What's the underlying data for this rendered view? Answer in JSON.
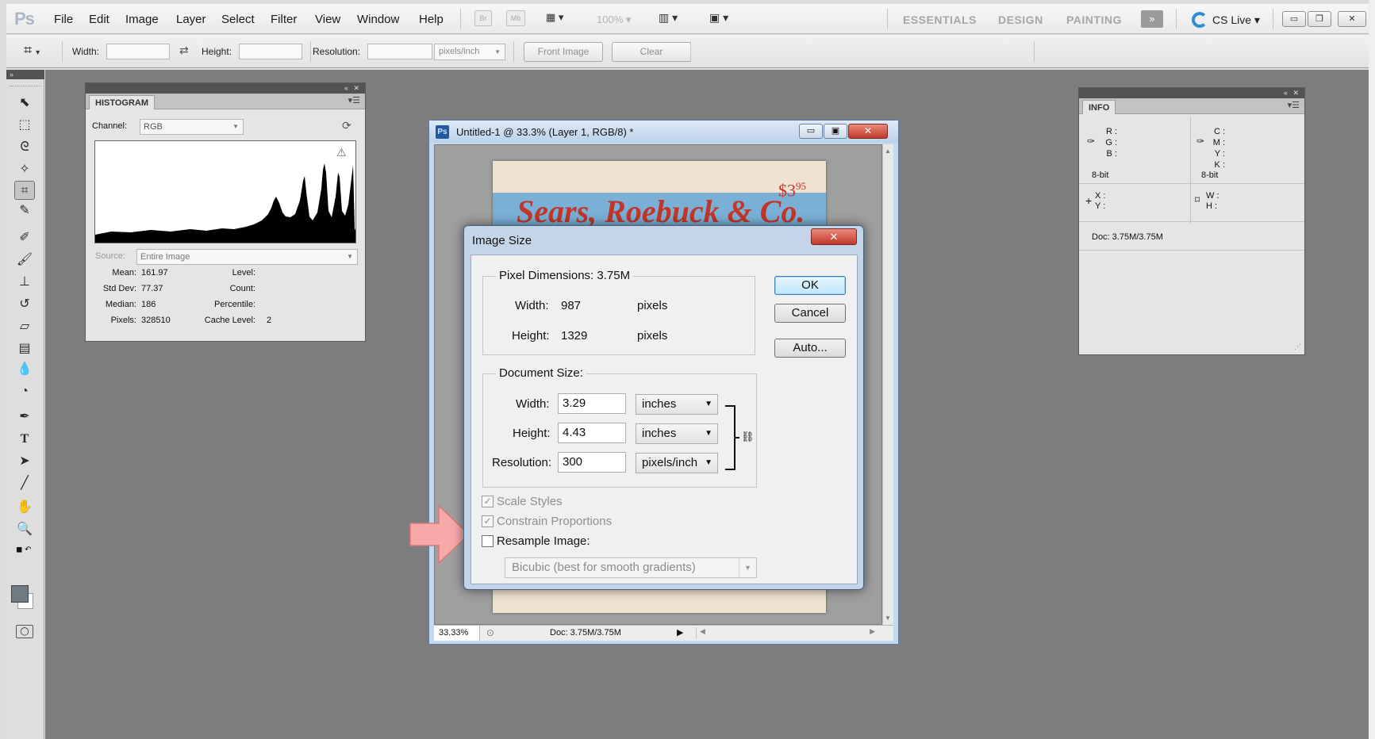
{
  "app": {
    "logo": "Ps",
    "menus": [
      "File",
      "Edit",
      "Image",
      "Layer",
      "Select",
      "Filter",
      "View",
      "Window",
      "Help"
    ],
    "menu_icons": [
      "Br",
      "Mb"
    ],
    "zoom_display": "100%",
    "workspaces": [
      "ESSENTIALS",
      "DESIGN",
      "PAINTING"
    ],
    "more_workspaces_icon": "double-chevron-icon",
    "cs_live": "CS Live",
    "accent_color": "#2a8fd3"
  },
  "options_bar": {
    "width_label": "Width:",
    "width_value": "",
    "height_label": "Height:",
    "height_value": "",
    "resolution_label": "Resolution:",
    "resolution_value": "",
    "resolution_unit": "pixels/inch",
    "front_image": "Front Image",
    "clear": "Clear"
  },
  "tools": [
    "move-tool",
    "rectangular-marquee-tool",
    "lasso-tool",
    "quick-selection-tool",
    "crop-tool",
    "eyedropper-tool",
    "spot-healing-brush-tool",
    "brush-tool",
    "clone-stamp-tool",
    "history-brush-tool",
    "eraser-tool",
    "gradient-tool",
    "blur-tool",
    "dodge-tool",
    "pen-tool",
    "type-tool",
    "path-selection-tool",
    "line-tool",
    "hand-tool",
    "zoom-tool"
  ],
  "histogram": {
    "tab": "HISTOGRAM",
    "channel_label": "Channel:",
    "channel_value": "RGB",
    "source_label": "Source:",
    "source_value": "Entire Image",
    "stats": {
      "mean_label": "Mean:",
      "mean": "161.97",
      "std_label": "Std Dev:",
      "std": "77.37",
      "median_label": "Median:",
      "median": "186",
      "pixels_label": "Pixels:",
      "pixels": "328510",
      "level_label": "Level:",
      "level": "",
      "count_label": "Count:",
      "count": "",
      "percentile_label": "Percentile:",
      "percentile": "",
      "cache_label": "Cache Level:",
      "cache": "2"
    }
  },
  "info": {
    "tab": "INFO",
    "rgb_labels": [
      "R :",
      "G :",
      "B :"
    ],
    "cmyk_labels": [
      "C :",
      "M :",
      "Y :",
      "K :"
    ],
    "bit_left": "8-bit",
    "bit_right": "8-bit",
    "xy_labels": [
      "X :",
      "Y :"
    ],
    "wh_labels": [
      "W :",
      "H :"
    ],
    "doc": "Doc: 3.75M/3.75M"
  },
  "document": {
    "title": "Untitled-1 @ 33.3% (Layer 1, RGB/8) *",
    "ps_badge": "Ps",
    "zoom": "33.33%",
    "status": "Doc: 3.75M/3.75M",
    "price": "$3.95",
    "price_cents": "95",
    "price_dollars": "$3",
    "brand": "Sears, Roebuck & Co."
  },
  "dialog": {
    "title": "Image Size",
    "pixel_dimensions_label": "Pixel Dimensions:",
    "pixel_dimensions_value": "3.75M",
    "pixel_width_label": "Width:",
    "pixel_width": "987",
    "pixel_width_unit": "pixels",
    "pixel_height_label": "Height:",
    "pixel_height": "1329",
    "pixel_height_unit": "pixels",
    "document_size_label": "Document Size:",
    "doc_width_label": "Width:",
    "doc_width": "3.29",
    "doc_width_unit": "inches",
    "doc_height_label": "Height:",
    "doc_height": "4.43",
    "doc_height_unit": "inches",
    "resolution_label": "Resolution:",
    "resolution": "300",
    "resolution_unit": "pixels/inch",
    "scale_styles": "Scale Styles",
    "scale_styles_checked": true,
    "constrain": "Constrain Proportions",
    "constrain_checked": true,
    "resample": "Resample Image:",
    "resample_checked": false,
    "resample_method": "Bicubic (best for smooth gradients)",
    "ok": "OK",
    "cancel": "Cancel",
    "auto": "Auto..."
  }
}
